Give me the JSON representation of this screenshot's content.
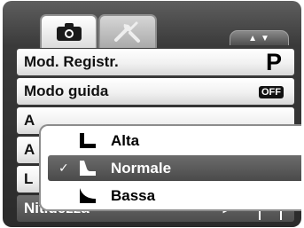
{
  "tabs": [
    {
      "icon": "camera-icon",
      "selected": true
    },
    {
      "icon": "tools-icon",
      "selected": false
    }
  ],
  "scroll_indicator": "▲▼",
  "menu": {
    "rows": [
      {
        "label": "Mod. Registr.",
        "value": "P"
      },
      {
        "label": "Modo guida",
        "value": "OFF"
      },
      {
        "label": "A"
      },
      {
        "label": "A"
      },
      {
        "label": "L"
      },
      {
        "label": "Nitidezza",
        "value_icon": "sharpness-normal-icon"
      }
    ]
  },
  "popup": {
    "options": [
      {
        "label": "Alta",
        "icon": "sharpness-high-icon",
        "selected": false
      },
      {
        "label": "Normale",
        "icon": "sharpness-normal-icon",
        "selected": true
      },
      {
        "label": "Bassa",
        "icon": "sharpness-low-icon",
        "selected": false
      }
    ],
    "check_mark": "✓"
  },
  "colors": {
    "selected_row": "#555555",
    "highlight": "#ffffff",
    "background": "#2b2b2b"
  }
}
